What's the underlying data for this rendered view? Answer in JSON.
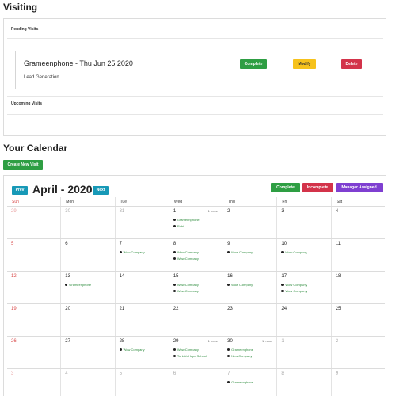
{
  "visiting": {
    "heading": "Visiting",
    "pending_label": "Pending Visits",
    "upcoming_label": "Upcoming Visits",
    "visit": {
      "title": "Grameenphone - Thu Jun 25 2020",
      "subtitle": "Lead Generation",
      "complete_label": "Complete",
      "modify_label": "Modify",
      "delete_label": "Delete"
    }
  },
  "calendar": {
    "heading": "Your Calendar",
    "create_label": "Create New Visit",
    "prev_label": "Prev",
    "next_label": "Next",
    "month_title": "April - 2020",
    "legend": {
      "complete": "Complete",
      "incomplete": "Incomplete",
      "manager_assigned": "Manager Assigned"
    },
    "colors": {
      "complete": "#2e9e43",
      "incomplete": "#d3334a",
      "manager_assigned": "#7f3fd1",
      "nav": "#1799b7"
    },
    "days_of_week": [
      "Sun",
      "Mon",
      "Tue",
      "Wed",
      "Thu",
      "Fri",
      "Sat"
    ],
    "weeks": [
      [
        {
          "day": "29",
          "other": true,
          "events": []
        },
        {
          "day": "30",
          "other": true,
          "events": []
        },
        {
          "day": "31",
          "other": true,
          "events": []
        },
        {
          "day": "1",
          "more": "1 more",
          "events": [
            "Grameenphone",
            "Robi"
          ]
        },
        {
          "day": "2",
          "events": []
        },
        {
          "day": "3",
          "events": []
        },
        {
          "day": "4",
          "events": []
        }
      ],
      [
        {
          "day": "5",
          "events": []
        },
        {
          "day": "6",
          "events": []
        },
        {
          "day": "7",
          "events": [
            "Wow Company"
          ]
        },
        {
          "day": "8",
          "events": [
            "Wow Company",
            "Wow Company"
          ]
        },
        {
          "day": "9",
          "events": [
            "Wow Company"
          ]
        },
        {
          "day": "10",
          "events": [
            "Wow Company"
          ]
        },
        {
          "day": "11",
          "events": []
        }
      ],
      [
        {
          "day": "12",
          "events": []
        },
        {
          "day": "13",
          "events": [
            "Grameenphone"
          ]
        },
        {
          "day": "14",
          "events": []
        },
        {
          "day": "15",
          "events": [
            "Wow Company",
            "Wow Company"
          ]
        },
        {
          "day": "16",
          "events": [
            "Wow Company"
          ]
        },
        {
          "day": "17",
          "events": [
            "Wow Company",
            "Wow Company"
          ]
        },
        {
          "day": "18",
          "events": []
        }
      ],
      [
        {
          "day": "19",
          "events": []
        },
        {
          "day": "20",
          "events": []
        },
        {
          "day": "21",
          "events": []
        },
        {
          "day": "22",
          "events": []
        },
        {
          "day": "23",
          "events": []
        },
        {
          "day": "24",
          "events": []
        },
        {
          "day": "25",
          "events": []
        }
      ],
      [
        {
          "day": "26",
          "events": []
        },
        {
          "day": "27",
          "events": []
        },
        {
          "day": "28",
          "events": [
            "Wow Company"
          ]
        },
        {
          "day": "29",
          "more": "1 more",
          "events": [
            "Wow Company",
            "Turkish Hope School"
          ]
        },
        {
          "day": "30",
          "more": "1 more",
          "events": [
            "Grameenphone",
            "New Company"
          ]
        },
        {
          "day": "1",
          "other": true,
          "events": []
        },
        {
          "day": "2",
          "other": true,
          "events": []
        }
      ],
      [
        {
          "day": "3",
          "other": true,
          "events": []
        },
        {
          "day": "4",
          "other": true,
          "events": []
        },
        {
          "day": "5",
          "other": true,
          "events": []
        },
        {
          "day": "6",
          "other": true,
          "events": []
        },
        {
          "day": "7",
          "other": true,
          "events": [
            "Grameenphone"
          ]
        },
        {
          "day": "8",
          "other": true,
          "events": []
        },
        {
          "day": "9",
          "other": true,
          "events": []
        }
      ]
    ]
  }
}
